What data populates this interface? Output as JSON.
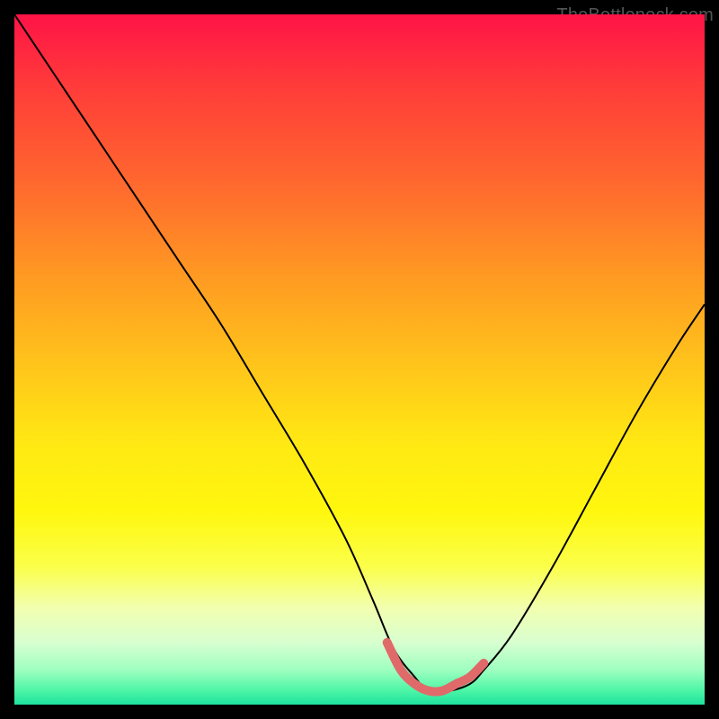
{
  "watermark": "TheBottleneck.com",
  "chart_data": {
    "type": "line",
    "title": "",
    "xlabel": "",
    "ylabel": "",
    "xlim": [
      0,
      100
    ],
    "ylim": [
      0,
      100
    ],
    "legend": [],
    "annotations": [],
    "background": {
      "style": "vertical_gradient",
      "stops": [
        {
          "pos": 0,
          "color": "#ff1347"
        },
        {
          "pos": 25,
          "color": "#ff6a2e"
        },
        {
          "pos": 52,
          "color": "#ffc81a"
        },
        {
          "pos": 72,
          "color": "#fff70e"
        },
        {
          "pos": 91,
          "color": "#d8ffd0"
        },
        {
          "pos": 100,
          "color": "#1de29e"
        }
      ]
    },
    "series": [
      {
        "name": "bottleneck-curve",
        "color": "#000000",
        "stroke_width": 2,
        "x": [
          0,
          6,
          12,
          18,
          24,
          30,
          36,
          42,
          48,
          52,
          55,
          58,
          60,
          63,
          66,
          68,
          72,
          78,
          84,
          90,
          96,
          100
        ],
        "values": [
          100,
          91,
          82,
          73,
          64,
          55,
          45,
          35,
          24,
          15,
          8,
          4,
          2,
          2,
          3,
          5,
          10,
          20,
          31,
          42,
          52,
          58
        ]
      },
      {
        "name": "optimal-zone-marker",
        "color": "#e06a6a",
        "stroke_width": 10,
        "stroke_linecap": "round",
        "x": [
          54,
          56,
          58,
          60,
          62,
          64,
          66,
          68
        ],
        "values": [
          9,
          5,
          3,
          2,
          2,
          3,
          4,
          6
        ]
      }
    ]
  }
}
